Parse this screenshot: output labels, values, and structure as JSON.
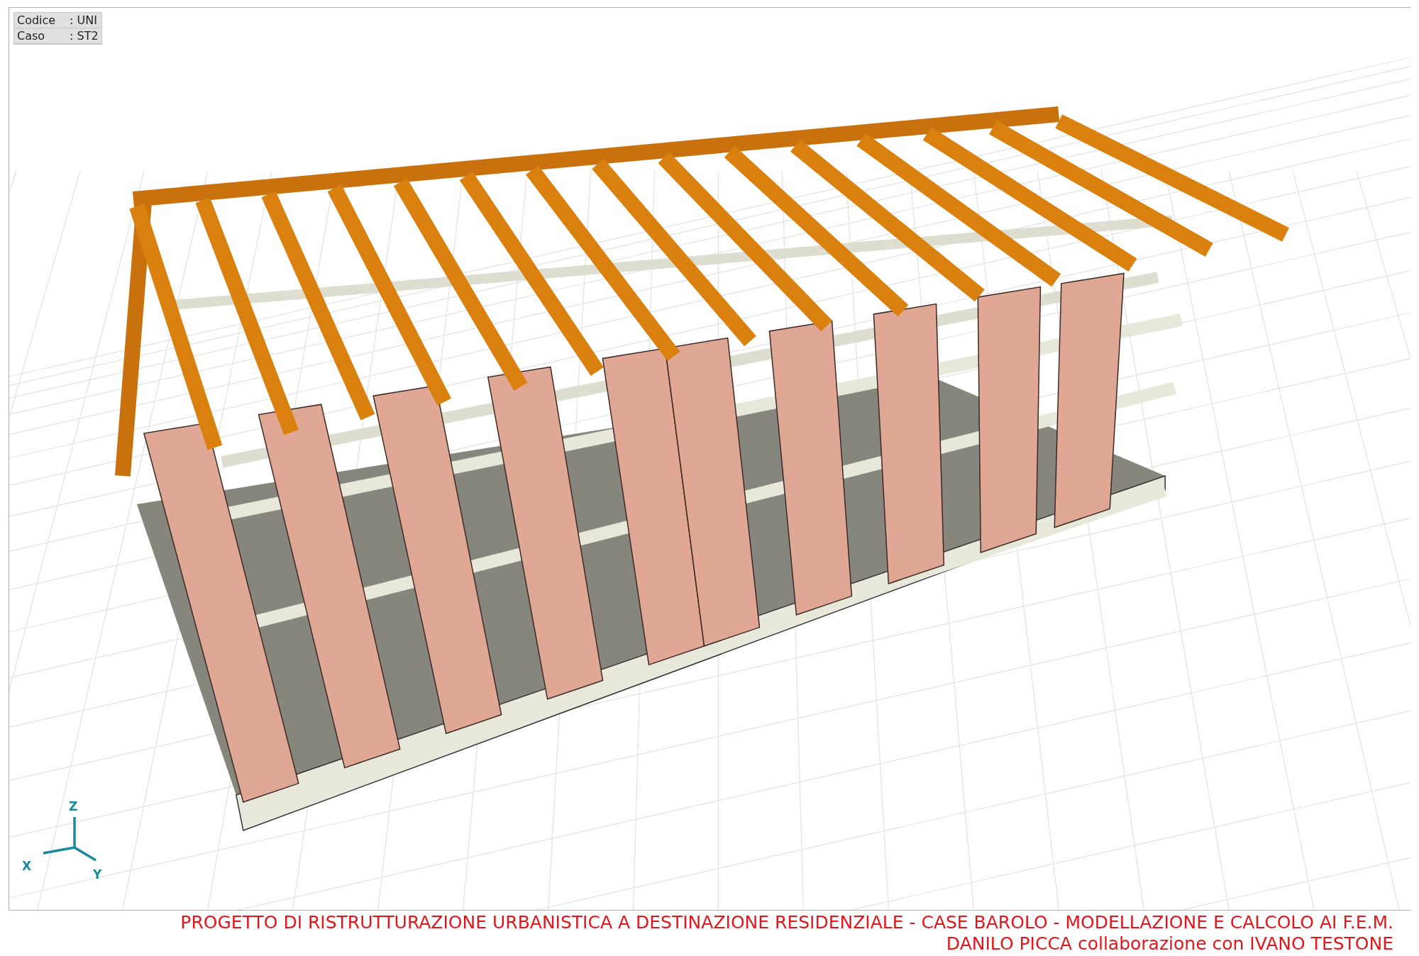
{
  "legend": [
    {
      "label": "Codice",
      "value": ": UNI"
    },
    {
      "label": "Caso",
      "value": ": ST2"
    }
  ],
  "axes": {
    "x": "X",
    "y": "Y",
    "z": "Z"
  },
  "caption": {
    "title": "PROGETTO DI RISTRUTTURAZIONE URBANISTICA A DESTINAZIONE RESIDENZIALE - CASE BAROLO - MODELLAZIONE E CALCOLO AI F.E.M.",
    "credits": "DANILO PICCA collaborazione con IVANO TESTONE"
  }
}
